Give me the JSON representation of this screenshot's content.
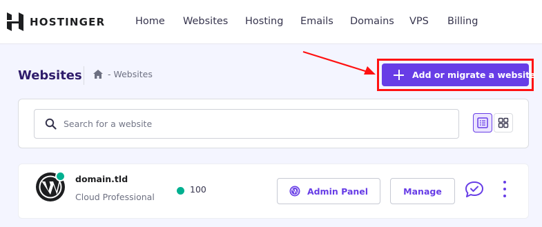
{
  "brand": {
    "name": "HOSTINGER"
  },
  "nav": {
    "items": [
      "Home",
      "Websites",
      "Hosting",
      "Emails",
      "Domains",
      "VPS",
      "Billing"
    ]
  },
  "page": {
    "title": "Websites",
    "breadcrumb": "- Websites",
    "add_button_label": "Add or migrate a website"
  },
  "search": {
    "placeholder": "Search for a website"
  },
  "site": {
    "domain": "domain.tld",
    "plan": "Cloud Professional",
    "score": "100",
    "admin_panel_label": "Admin Panel",
    "manage_label": "Manage"
  },
  "colors": {
    "accent": "#673de6",
    "highlight": "#ff1111",
    "success": "#00b090",
    "title": "#2f1c6a"
  }
}
